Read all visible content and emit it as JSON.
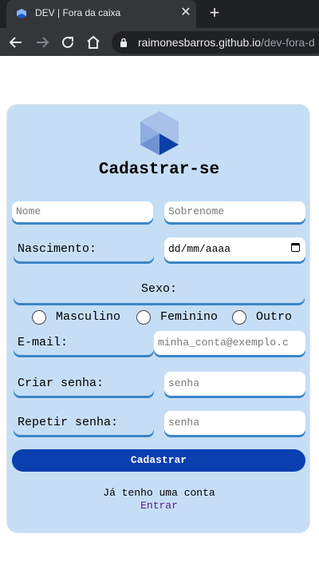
{
  "browser": {
    "tab_title": "DEV | Fora da caixa",
    "url_host": "raimonesbarros.github.io",
    "url_path": "/dev-fora-d"
  },
  "form": {
    "title": "Cadastrar-se",
    "first_name_placeholder": "Nome",
    "last_name_placeholder": "Sobrenome",
    "birth_label": "Nascimento:",
    "birth_value": "dd/mm/aaaa",
    "sex_label": "Sexo:",
    "sex_options": [
      "Masculino",
      "Feminino",
      "Outro"
    ],
    "email_label": "E-mail:",
    "email_placeholder": "minha_conta@exemplo.c",
    "password_label": "Criar senha:",
    "password_placeholder": "senha",
    "repeat_label": "Repetir senha:",
    "repeat_placeholder": "senha",
    "submit_label": "Cadastrar",
    "have_account": "Já tenho uma conta",
    "login_link": "Entrar"
  },
  "colors": {
    "card_bg": "#c6def5",
    "accent": "#3a86c8",
    "button": "#0a3fb0",
    "link": "#551a8b"
  }
}
